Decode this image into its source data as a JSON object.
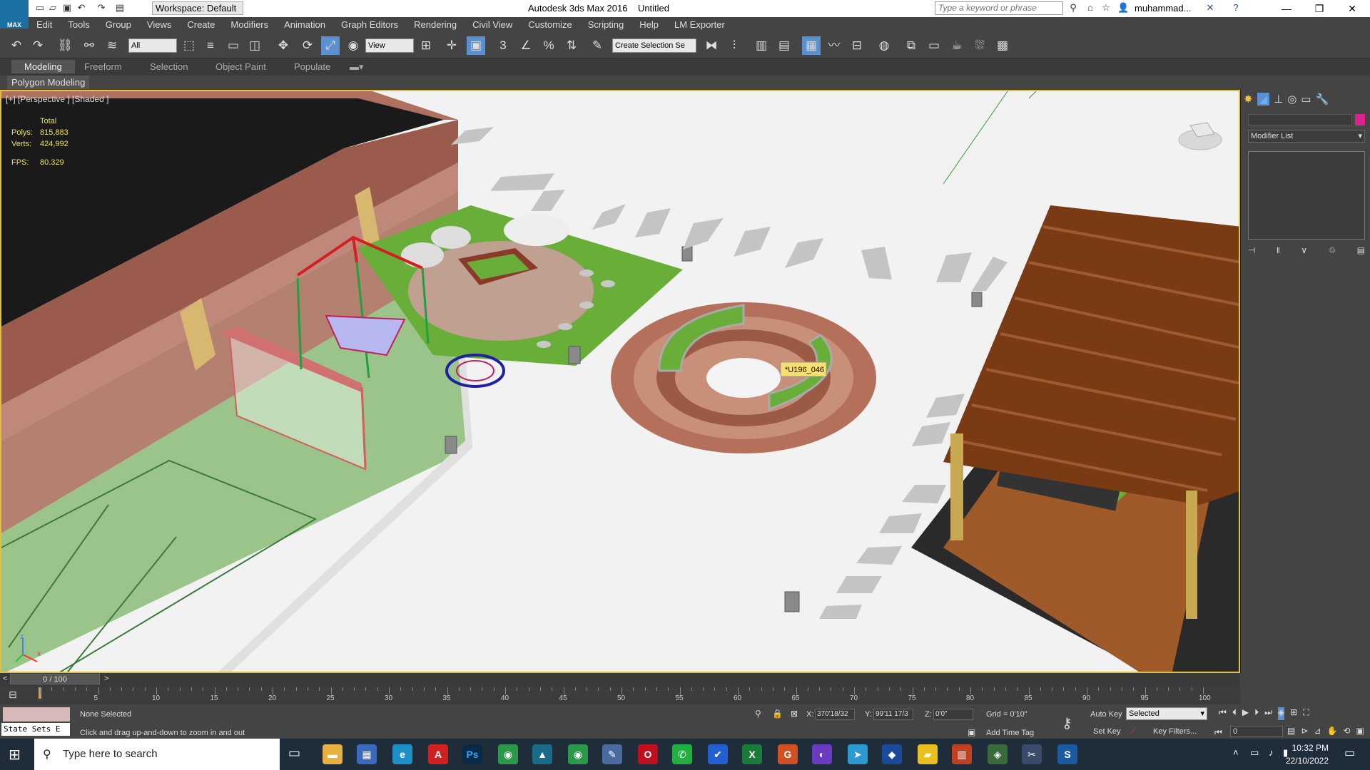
{
  "title_bar": {
    "logo_text": "MAX",
    "workspace": "Workspace: Default",
    "app_title": "Autodesk 3ds Max 2016",
    "file_title": "Untitled",
    "search_placeholder": "Type a keyword or phrase",
    "user": "muhammad..."
  },
  "menu": [
    "Edit",
    "Tools",
    "Group",
    "Views",
    "Create",
    "Modifiers",
    "Animation",
    "Graph Editors",
    "Rendering",
    "Civil View",
    "Customize",
    "Scripting",
    "Help",
    "LM Exporter"
  ],
  "toolbar": {
    "selection_filter": "All",
    "ref_coord": "View",
    "selection_set": "Create Selection Se"
  },
  "ribbon": {
    "tabs": [
      "Modeling",
      "Freeform",
      "Selection",
      "Object Paint",
      "Populate"
    ],
    "active_tab": "Modeling",
    "panel": "Polygon Modeling"
  },
  "viewport": {
    "label": "[+] [Perspective ] [Shaded ]",
    "stats": {
      "header": "Total",
      "polys_label": "Polys:",
      "polys": "815,883",
      "verts_label": "Verts:",
      "verts": "424,992",
      "fps_label": "FPS:",
      "fps": "80.329"
    },
    "tooltip": "*U196_046",
    "axis": {
      "x": "x",
      "y": "y",
      "z": "z"
    }
  },
  "command_panel": {
    "modifier_list": "Modifier List",
    "color_swatch": "#e0208c"
  },
  "time": {
    "position": "0 / 100",
    "ticks": [
      "5",
      "10",
      "15",
      "20",
      "25",
      "30",
      "35",
      "40",
      "45",
      "50",
      "55",
      "60",
      "65",
      "70",
      "75",
      "80",
      "85",
      "90",
      "95",
      "100"
    ],
    "current_frame": "0"
  },
  "status": {
    "selection": "None Selected",
    "prompt": "Click and drag up-and-down to zoom in and out",
    "state_sets": "State Sets E",
    "x_label": "X:",
    "x": "370'18/32",
    "y_label": "Y:",
    "y": "99'11 17/3",
    "z_label": "Z:",
    "z": "0'0\"",
    "grid": "Grid = 0'10\"",
    "add_time_tag": "Add Time Tag",
    "auto_key": "Auto Key",
    "set_key": "Set Key",
    "key_mode": "Selected",
    "key_filters": "Key Filters..."
  },
  "taskbar": {
    "search_placeholder": "Type here to search",
    "time": "10:32 PM",
    "date": "22/10/2022"
  }
}
